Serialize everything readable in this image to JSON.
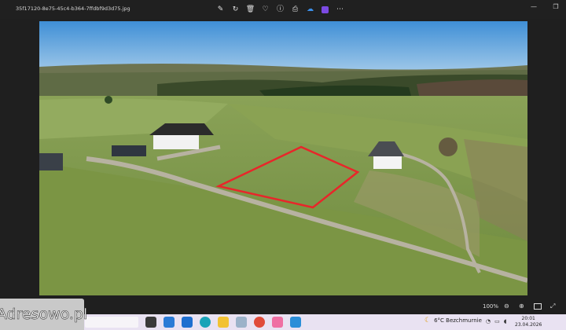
{
  "window": {
    "filename": "35f17120-8e75-45c4-b364-7ffdbf9d3d75.jpg"
  },
  "toolbar": {
    "icons": [
      "edit-icon",
      "rotate-icon",
      "delete-icon",
      "favorite-icon",
      "info-icon",
      "print-icon",
      "onedrive-icon",
      "clipchamp-icon",
      "more-icon"
    ]
  },
  "statusbar": {
    "zoom": "100%"
  },
  "taskbar": {
    "weather": "6°C  Bezchmurnie",
    "time": "20:01",
    "date": "23.04.2026"
  },
  "watermark": {
    "text": "Adresowo.pl"
  },
  "colors": {
    "plot_outline": "#e8262a",
    "sky": "#5aa1d9",
    "grass": "#7d9a4a"
  }
}
